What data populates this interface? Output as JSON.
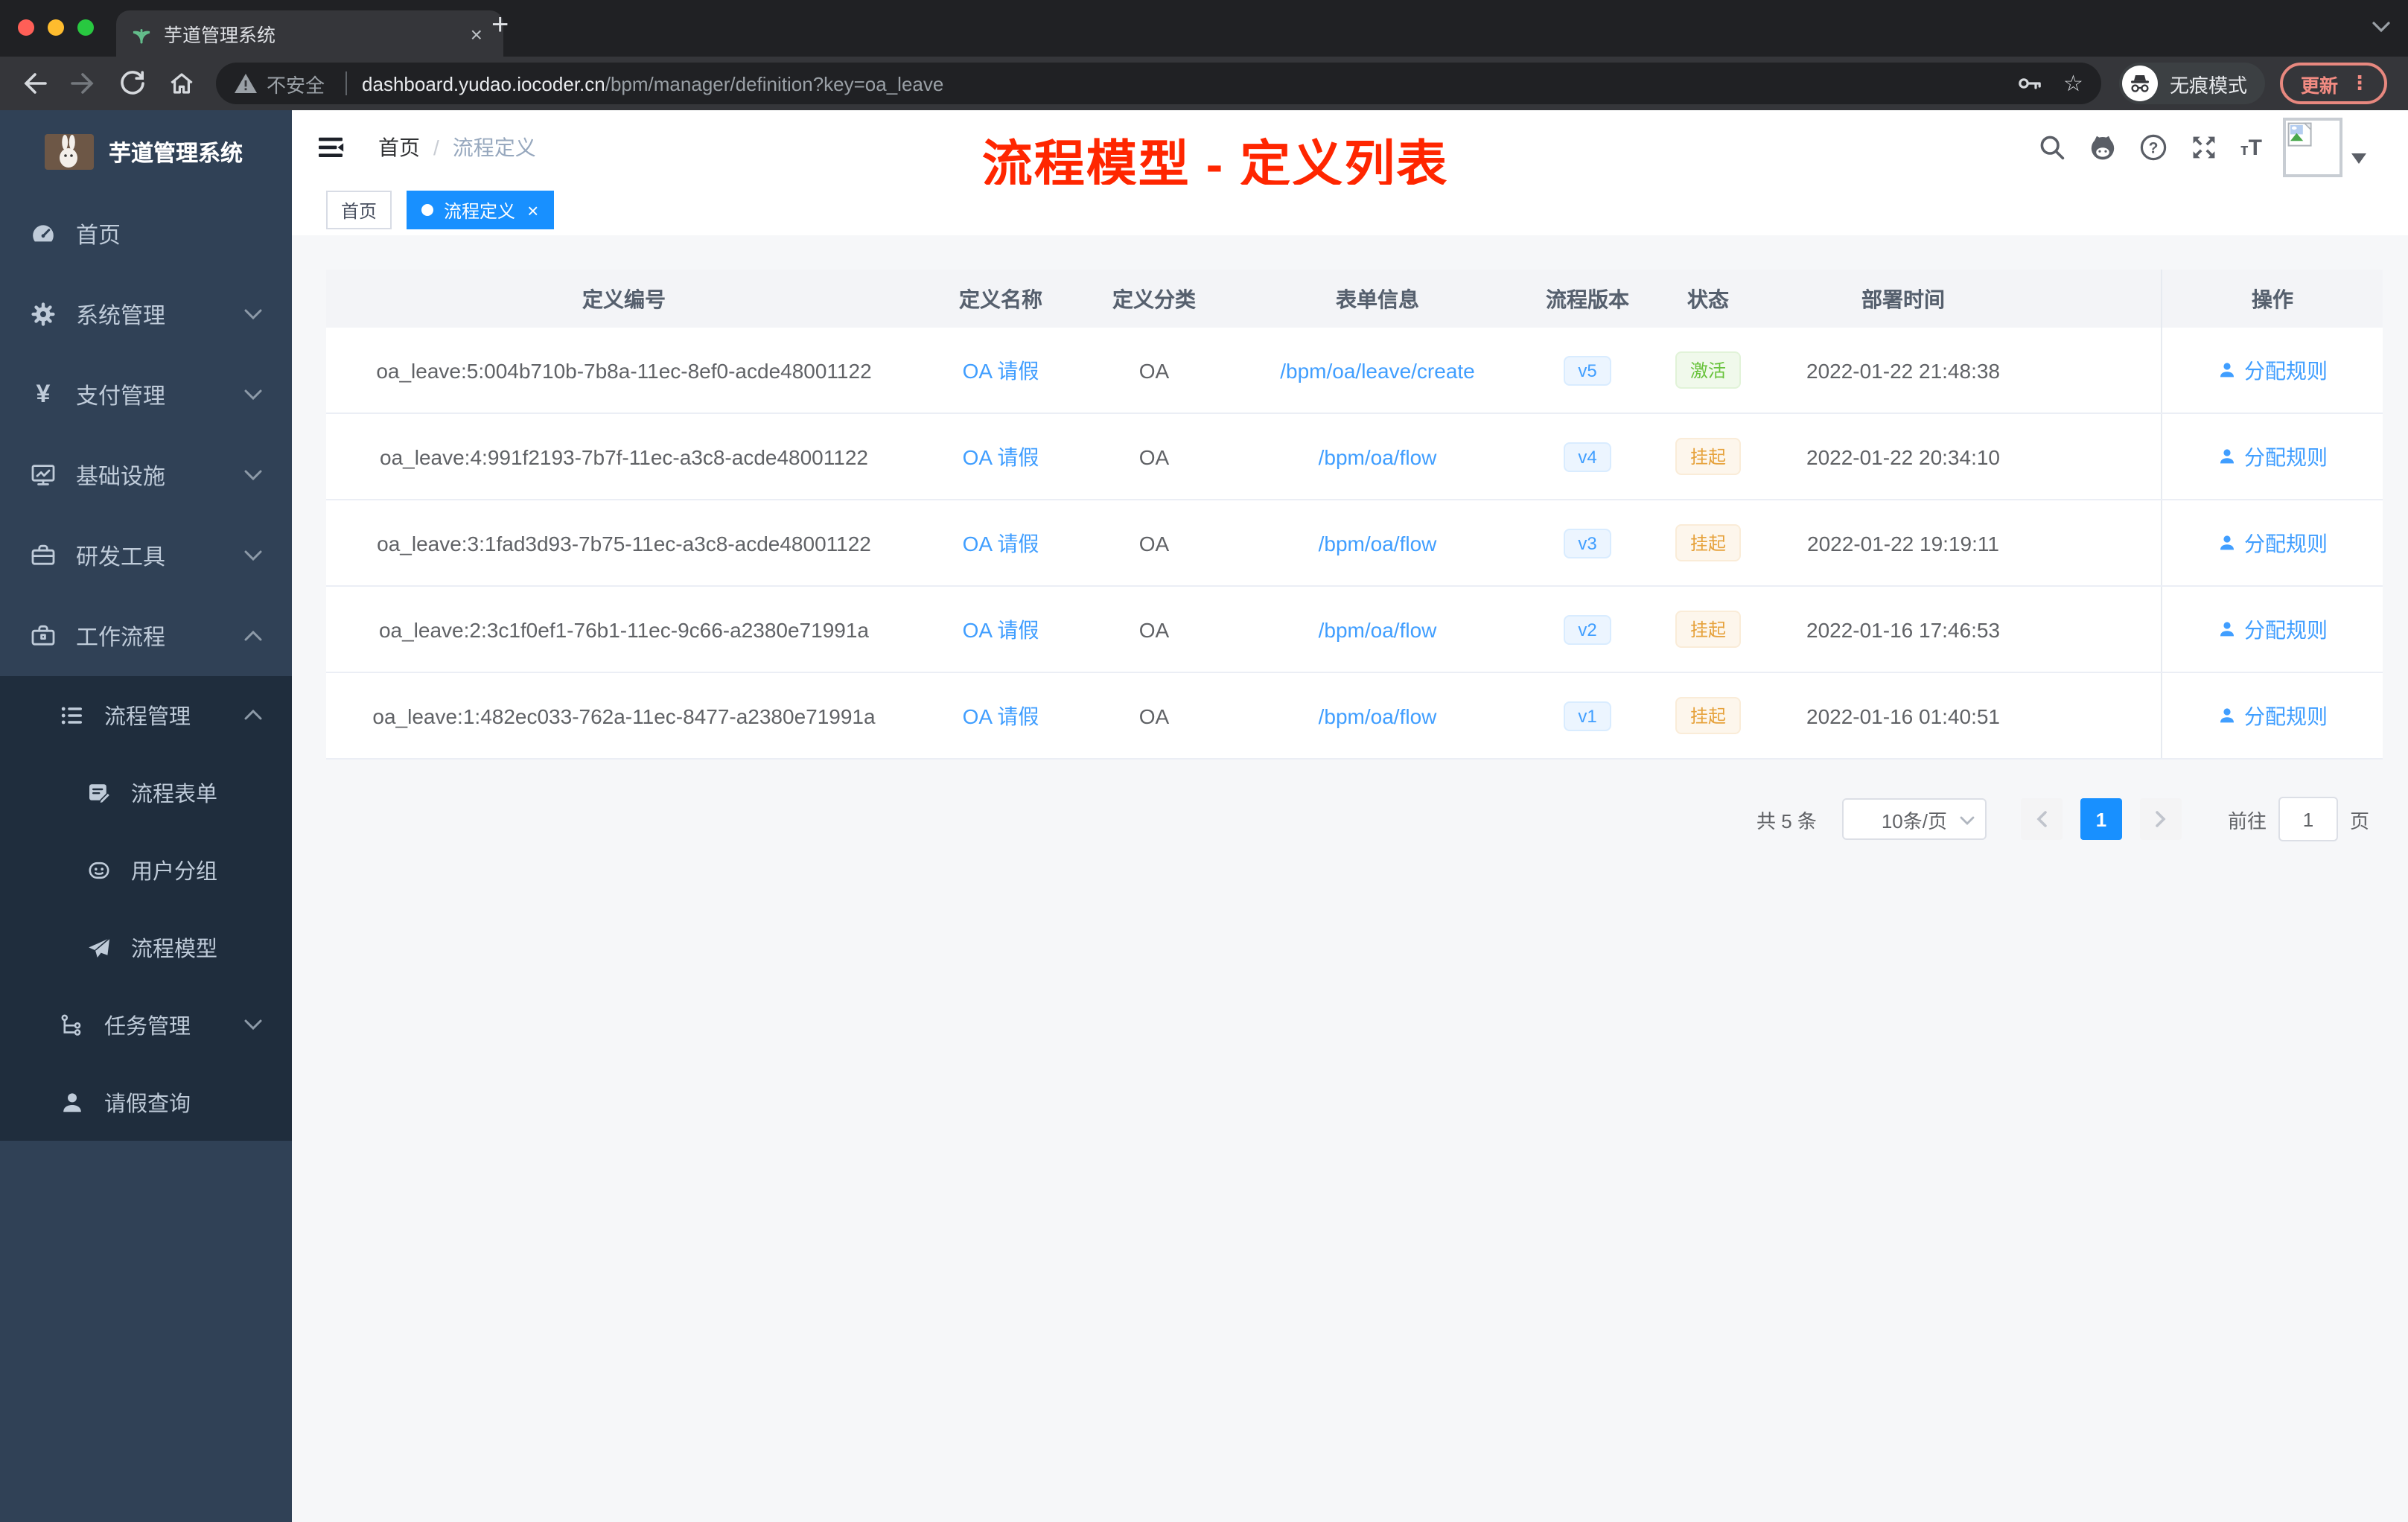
{
  "browser": {
    "tab_title": "芋道管理系统",
    "security_label": "不安全",
    "url_host": "dashboard.yudao.iocoder.cn",
    "url_path": "/bpm/manager/definition?key=oa_leave",
    "incognito_label": "无痕模式",
    "update_label": "更新"
  },
  "glyphs": {
    "close": "×",
    "plus": "+",
    "dots": "⋮",
    "star": "☆",
    "yen": "¥",
    "font_small": "т",
    "font_big": "T",
    "question": "?",
    "warning_mark": "!"
  },
  "sidebar": {
    "app_title": "芋道管理系统",
    "menu": {
      "home": "首页",
      "system": "系统管理",
      "payment": "支付管理",
      "infra": "基础设施",
      "dev_tools": "研发工具",
      "workflow": "工作流程",
      "process_mgmt": "流程管理",
      "process_form": "流程表单",
      "user_group": "用户分组",
      "process_model": "流程模型",
      "task_mgmt": "任务管理",
      "leave_query": "请假查询"
    }
  },
  "header": {
    "breadcrumb_home": "首页",
    "breadcrumb_sep": "/",
    "breadcrumb_current": "流程定义",
    "annotation_title": "流程模型 - 定义列表"
  },
  "tags": {
    "home": "首页",
    "active": "流程定义"
  },
  "table": {
    "columns": [
      "定义编号",
      "定义名称",
      "定义分类",
      "表单信息",
      "流程版本",
      "状态",
      "部署时间",
      "操作"
    ],
    "rows": [
      {
        "id": "oa_leave:5:004b710b-7b8a-11ec-8ef0-acde48001122",
        "name": "OA 请假",
        "category": "OA",
        "form": "/bpm/oa/leave/create",
        "version": "v5",
        "status": "激活",
        "time": "2022-01-22 21:48:38",
        "action": "分配规则"
      },
      {
        "id": "oa_leave:4:991f2193-7b7f-11ec-a3c8-acde48001122",
        "name": "OA 请假",
        "category": "OA",
        "form": "/bpm/oa/flow",
        "version": "v4",
        "status": "挂起",
        "time": "2022-01-22 20:34:10",
        "action": "分配规则"
      },
      {
        "id": "oa_leave:3:1fad3d93-7b75-11ec-a3c8-acde48001122",
        "name": "OA 请假",
        "category": "OA",
        "form": "/bpm/oa/flow",
        "version": "v3",
        "status": "挂起",
        "time": "2022-01-22 19:19:11",
        "action": "分配规则"
      },
      {
        "id": "oa_leave:2:3c1f0ef1-76b1-11ec-9c66-a2380e71991a",
        "name": "OA 请假",
        "category": "OA",
        "form": "/bpm/oa/flow",
        "version": "v2",
        "status": "挂起",
        "time": "2022-01-16 17:46:53",
        "action": "分配规则"
      },
      {
        "id": "oa_leave:1:482ec033-762a-11ec-8477-a2380e71991a",
        "name": "OA 请假",
        "category": "OA",
        "form": "/bpm/oa/flow",
        "version": "v1",
        "status": "挂起",
        "time": "2022-01-16 01:40:51",
        "action": "分配规则"
      }
    ]
  },
  "pagination": {
    "total": "共 5 条",
    "page_size": "10条/页",
    "page": "1",
    "goto_label": "前往",
    "goto_value": "1",
    "unit_label": "页"
  },
  "colors": {
    "accent_blue": "#1890ff",
    "link_blue": "#409eff",
    "success_green": "#67c23a",
    "warning_orange": "#e6a23c",
    "annotation_red": "#ff2600",
    "sidebar_bg": "#304156",
    "submenu_bg": "#1f2d3d"
  }
}
